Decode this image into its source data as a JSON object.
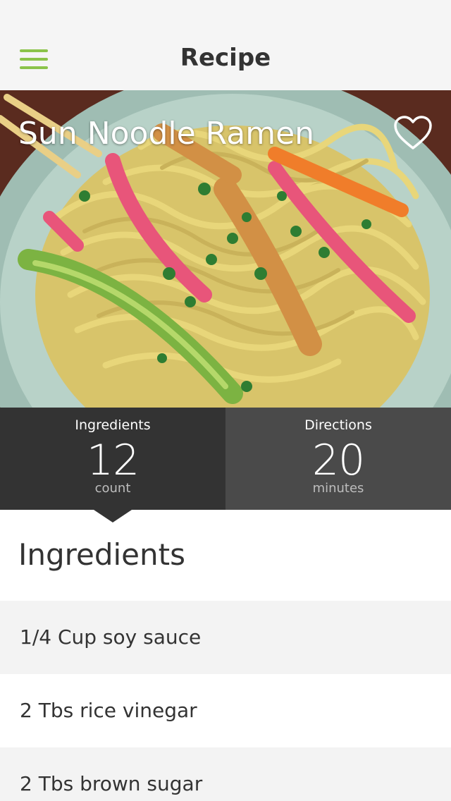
{
  "navbar": {
    "title": "Recipe",
    "menu_icon": "hamburger-menu-icon",
    "accent_color": "#8bc34a"
  },
  "recipe": {
    "title": "Sun Noodle Ramen",
    "favorite_icon": "heart-outline-icon"
  },
  "stats": {
    "ingredients": {
      "label": "Ingredients",
      "value": "12",
      "unit": "count"
    },
    "directions": {
      "label": "Directions",
      "value": "20",
      "unit": "minutes"
    }
  },
  "section": {
    "title": "Ingredients"
  },
  "ingredients": [
    {
      "text": "1/4 Cup soy sauce"
    },
    {
      "text": "2 Tbs rice vinegar"
    },
    {
      "text": "2 Tbs brown sugar"
    }
  ]
}
